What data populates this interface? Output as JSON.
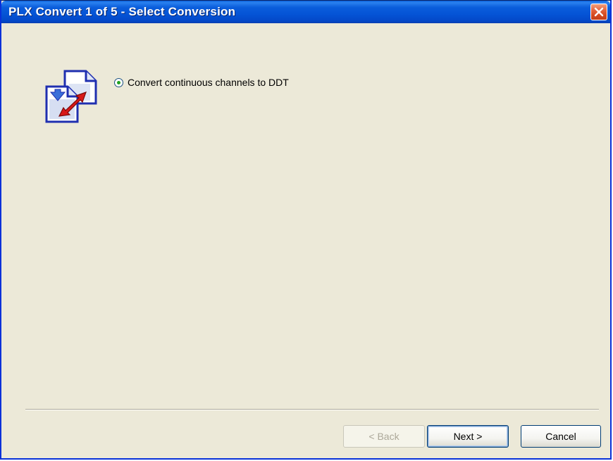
{
  "window": {
    "title": "PLX Convert 1 of 5 - Select Conversion",
    "close_icon": "close-icon"
  },
  "content": {
    "icon": "convert-documents-icon",
    "options": [
      {
        "label": "Convert continuous channels to DDT",
        "selected": true
      }
    ]
  },
  "buttons": {
    "back_label": "< Back",
    "next_label": "Next >",
    "cancel_label": "Cancel"
  },
  "colors": {
    "titlebar": "#0554d6",
    "dialog_bg": "#ece9d8",
    "close_button": "#d44a1f",
    "radio_dot": "#21a121"
  }
}
